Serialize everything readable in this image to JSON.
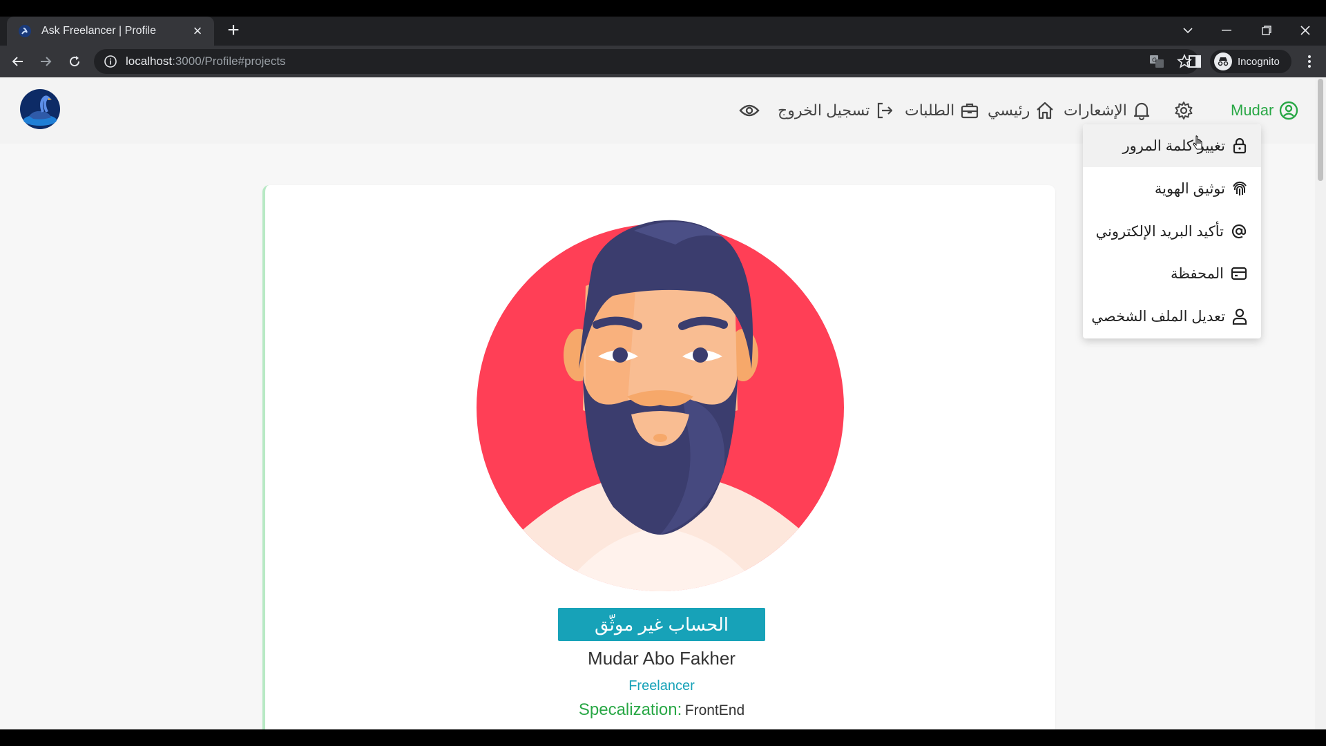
{
  "browser": {
    "tab_title": "Ask Freelancer | Profile",
    "url_host": "localhost",
    "url_path": ":3000/Profile#projects",
    "incognito_label": "Incognito"
  },
  "navbar": {
    "user_name": "Mudar",
    "notifications_label": "الإشعارات",
    "home_label": "رئيسي",
    "requests_label": "الطلبات",
    "logout_label": "تسجيل الخروج"
  },
  "dropdown": {
    "items": [
      {
        "label": "تغيير كلمة المرور",
        "icon": "lock-icon"
      },
      {
        "label": "توثيق الهوية",
        "icon": "fingerprint-icon"
      },
      {
        "label": "تأكيد البريد الإلكتروني",
        "icon": "at-icon"
      },
      {
        "label": "المحفظة",
        "icon": "wallet-icon"
      },
      {
        "label": "تعديل الملف الشخصي",
        "icon": "user-icon"
      }
    ]
  },
  "profile": {
    "status": "الحساب غير موثّق",
    "name": "Mudar Abo Fakher",
    "role": "Freelancer",
    "specialization_label": "Specalization:",
    "specialization_value": "FrontEnd"
  },
  "colors": {
    "accent_teal": "#17a2b8",
    "accent_green": "#28a745",
    "avatar_circle": "#ff3f56",
    "hair": "#3b3d6e"
  }
}
